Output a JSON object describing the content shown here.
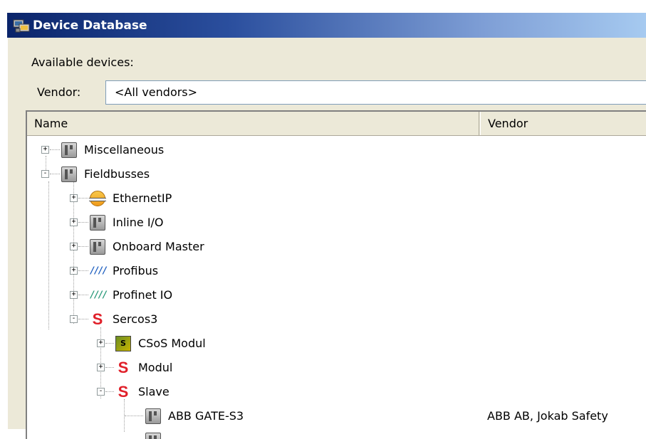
{
  "window": {
    "title": "Device Database",
    "icon": "device-database-icon"
  },
  "available_label": "Available devices:",
  "vendor_label": "Vendor:",
  "vendor_value": "<All vendors>",
  "columns": {
    "name": "Name",
    "vendor": "Vendor"
  },
  "tree": [
    {
      "label": "Miscellaneous",
      "icon": "module-icon",
      "expander": "+",
      "vendor": ""
    },
    {
      "label": "Fieldbusses",
      "icon": "module-icon",
      "expander": "-",
      "vendor": ""
    },
    {
      "label": "EthernetIP",
      "icon": "ethernet-icon",
      "expander": "+",
      "vendor": ""
    },
    {
      "label": "Inline I/O",
      "icon": "module-icon",
      "expander": "+",
      "vendor": ""
    },
    {
      "label": "Onboard Master",
      "icon": "module-icon",
      "expander": "+",
      "vendor": ""
    },
    {
      "label": "Profibus",
      "icon": "bus-icon",
      "expander": "+",
      "vendor": ""
    },
    {
      "label": "Profinet IO",
      "icon": "bus-icon",
      "expander": "+",
      "vendor": ""
    },
    {
      "label": "Sercos3",
      "icon": "sercos-icon",
      "expander": "-",
      "vendor": ""
    },
    {
      "label": "CSoS Modul",
      "icon": "csos-icon",
      "expander": "+",
      "vendor": ""
    },
    {
      "label": "Modul",
      "icon": "sercos-icon",
      "expander": "+",
      "vendor": ""
    },
    {
      "label": "Slave",
      "icon": "sercos-icon",
      "expander": "-",
      "vendor": ""
    },
    {
      "label": "ABB GATE-S3",
      "icon": "module-icon",
      "expander": "",
      "vendor": "ABB AB, Jokab Safety"
    }
  ]
}
